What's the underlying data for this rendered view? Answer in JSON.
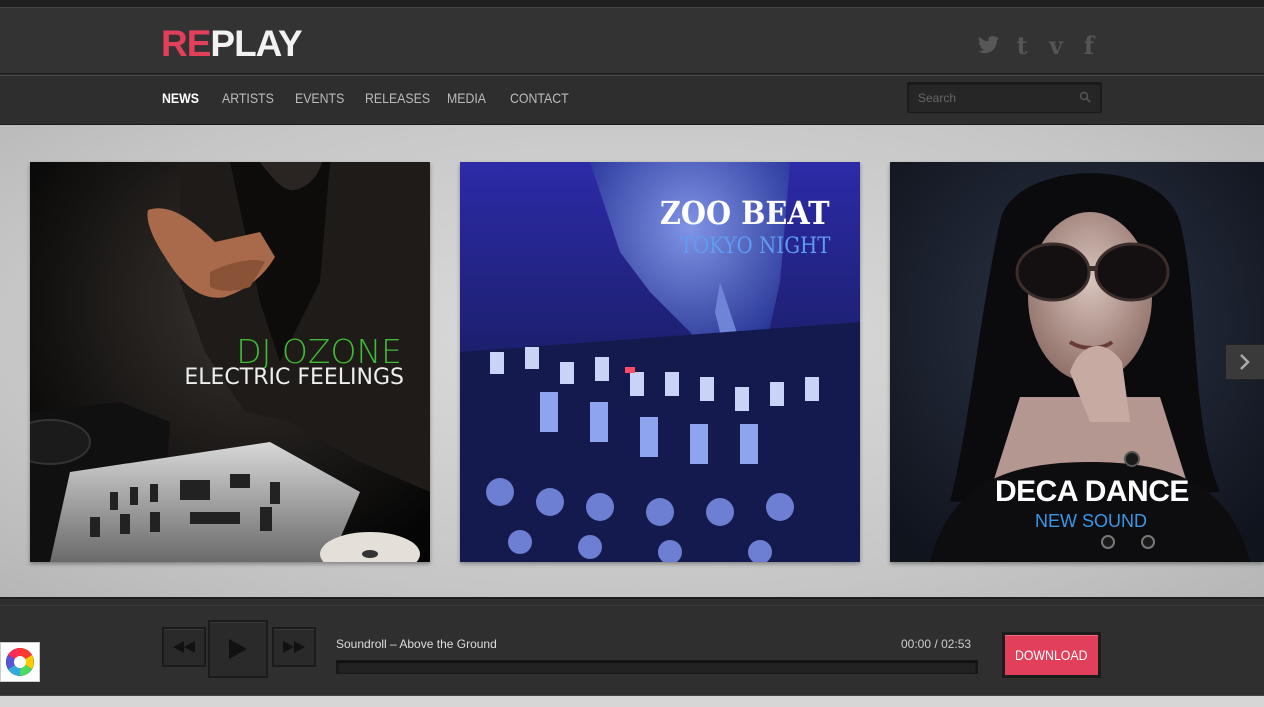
{
  "brand": {
    "logo_accent": "RE",
    "logo_rest": "PLAY",
    "accent_color": "#e23f5a"
  },
  "social": [
    "twitter-icon",
    "tumblr-icon",
    "vimeo-icon",
    "facebook-icon"
  ],
  "nav": {
    "items": [
      {
        "label": "NEWS",
        "active": true
      },
      {
        "label": "ARTISTS"
      },
      {
        "label": "EVENTS"
      },
      {
        "label": "RELEASES"
      },
      {
        "label": "MEDIA"
      },
      {
        "label": "CONTACT"
      }
    ]
  },
  "search": {
    "placeholder": "Search",
    "value": ""
  },
  "slides": [
    {
      "title": "DJ OZONE",
      "subtitle": "ELECTRIC FEELINGS"
    },
    {
      "title": "ZOO BEAT",
      "subtitle": "TOKYO NIGHT"
    },
    {
      "title": "DECA DANCE",
      "subtitle": "NEW SOUND"
    }
  ],
  "player": {
    "track": "Soundroll – Above the Ground",
    "current_time": "00:00",
    "separator": "/",
    "duration": "02:53",
    "progress": 0,
    "download_label": "DOWNLOAD"
  }
}
